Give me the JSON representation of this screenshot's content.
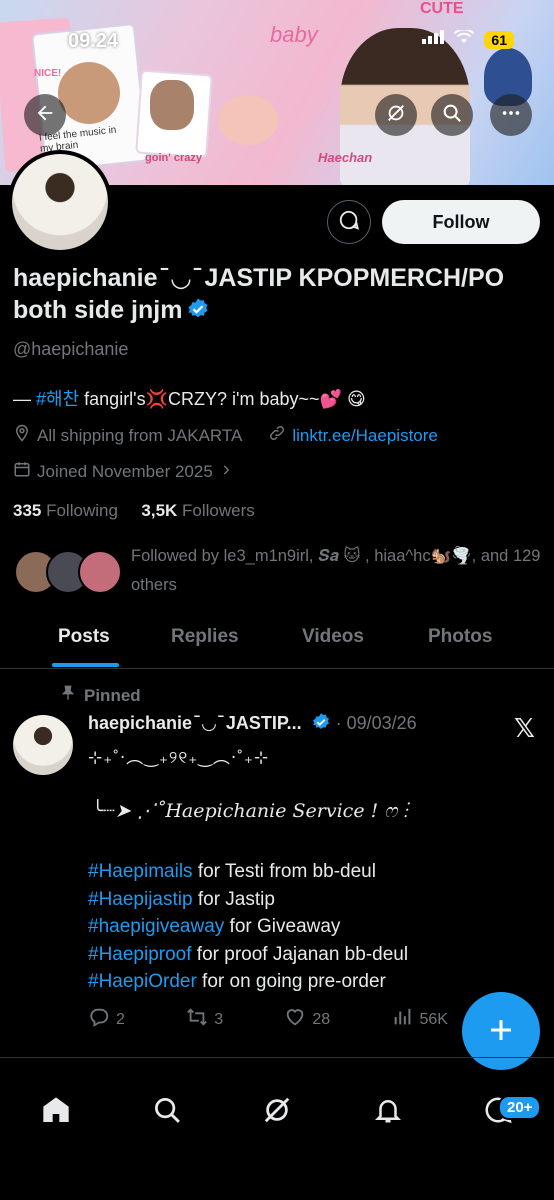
{
  "status": {
    "time": "09.24",
    "battery": "61"
  },
  "banner": {
    "sticker_text_1": "baby",
    "sticker_text_2": "CUTE",
    "sticker_text_3": "goin' crazy",
    "sticker_text_4": "Haechan",
    "sticker_text_5": "I feel the music in my brain",
    "sticker_text_6": "NICE!"
  },
  "profile": {
    "follow_label": "Follow",
    "display_name": "haepichanie ̄ ◡ ̄ JASTIP KPOPMERCH/PO both side jnjm",
    "handle": "@haepichanie",
    "bio_prefix": "— ",
    "bio_hashtag": "#해찬",
    "bio_rest": " fangirl's💢CRZY? i'm baby~~💕 😋",
    "location": "All shipping from JAKARTA",
    "website": "linktr.ee/Haepistore",
    "joined": "Joined November 2025",
    "following_count": "335",
    "following_label": " Following",
    "followers_count": "3,5K",
    "followers_label": " Followers",
    "followed_by": "Followed by le3_m1n9irl, 𝑺𝒂 🐱 , hiaa^hc🐿️🌪️, and 129 others"
  },
  "tabs": [
    "Posts",
    "Replies",
    "Videos",
    "Photos"
  ],
  "post": {
    "pinned_label": "Pinned",
    "author": "haepichanie ̄ ◡ ̄ JASTIP...",
    "date": "· 09/03/26",
    "deco_line": "⊹₊˚‧︵‿₊୨୧₊‿︵‧˚₊⊹",
    "service_line": "╰┈➤ ⋰˚Haepichanie Service ! ෆ ⋮",
    "tags": [
      {
        "tag": "#Haepimails",
        "text": " for Testi from bb-deul"
      },
      {
        "tag": "#Haepijastip",
        "text": " for Jastip"
      },
      {
        "tag": "#haepigiveaway",
        "text": " for Giveaway"
      },
      {
        "tag": "#Haepiproof",
        "text": " for proof Jajanan bb-deul"
      },
      {
        "tag": "#HaepiOrder",
        "text": " for on going pre-order"
      }
    ],
    "replies": "2",
    "reposts": "3",
    "likes": "28",
    "views": "56K"
  },
  "nav": {
    "messages_badge": "20+"
  },
  "icons": [
    "back-arrow-icon",
    "grok-icon",
    "search-icon",
    "more-icon",
    "message-icon",
    "verified-badge-icon",
    "location-icon",
    "link-icon",
    "calendar-icon",
    "pin-icon",
    "x-logo-icon",
    "reply-icon",
    "repost-icon",
    "like-icon",
    "views-icon",
    "compose-icon",
    "home-icon",
    "explore-icon",
    "notifications-icon",
    "messages-icon"
  ],
  "colors": {
    "accent": "#1d9bf0",
    "background": "#000000",
    "muted": "#71767b"
  }
}
